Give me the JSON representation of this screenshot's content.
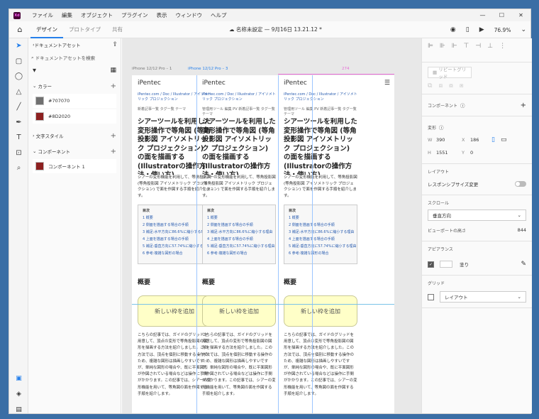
{
  "app": {
    "logo": "Xd",
    "menu": [
      "ファイル",
      "編集",
      "オブジェクト",
      "プラグイン",
      "表示",
      "ウィンドウ",
      "ヘルプ"
    ],
    "window_controls": [
      "—",
      "☐",
      "✕"
    ]
  },
  "toolbar": {
    "tabs": [
      "デザイン",
      "プロトタイプ",
      "共有"
    ],
    "doc_title": "☁ 名称未設定 — 9月16日 13.21.12 *",
    "zoom": "76.9%"
  },
  "left_panel": {
    "header": "ドキュメントアセット",
    "search_placeholder": "ドキュメントアセットを検索",
    "colors_label": "カラー",
    "colors": [
      {
        "label": "#707070",
        "hex": "#707070"
      },
      {
        "label": "#8D2020",
        "hex": "#8D2020"
      }
    ],
    "char_styles_label": "文字スタイル",
    "components_label": "コンポーネント",
    "components": [
      {
        "label": "コンポーネント 1",
        "hex": "#8D2020"
      }
    ]
  },
  "canvas": {
    "artboard_labels": [
      "iPhone 12/12 Pro – 1",
      "iPhone 12/12 Pro – 3"
    ],
    "measure_label": "274",
    "columns": [
      {
        "logo": "iPentec",
        "breadcrumb": "iPentec.com / Doc / Illustrator / アイソメトリック プロジェクション",
        "meta": "新着記事一覧  タグ一覧  テーマ",
        "title": "シアーツールを利用した変形操作で等角図 (等角投影図 アイソメトリック プロジェクション) の面を描画する (Illustratorの操作方法・使い方)",
        "desc": "シアーの変形機能を利用して、等角投影図 (等角投影図 アイソメトリック プロジェクション) で面を作図する手順を紹介します。",
        "heading": "概要",
        "box": "新しい枠を追加",
        "body": "こちらの記事では、ガイドのグリッドを用意して、頂点の変形で等角投影図の図形を描画する方法を紹介しました。この方法では、頂点を個別に移動する操作のため、複雑な図形は描画しやすいですが、単純な図形の場合や、既に平面図形が作図されている場合などは操作に手間がかかります。この記事では、シアーの変形機能を用いて、等角図の面を作図する手順を紹介します。"
      },
      {
        "logo": "iPentec",
        "breadcrumb": "iPentec.com / Doc / Illustrator / アイソメトリック プロジェクション",
        "meta": "管理用ツール 編集 PV  新着記事一覧  タグ一覧  テーマ",
        "title": "シアーツールを利用した変形操作で等角図 (等角投影図 アイソメトリック プロジェクション) の面を描画する (Illustratorの操作方法・使い方)",
        "desc": "シアーの変形機能を利用して、等角投影図 (等角投影図 アイソメトリック プロジェクション) で面を作図する手順を紹介します。",
        "heading": "概要",
        "box": "新しい枠を追加",
        "body": "こちらの記事では、ガイドのグリッドを用意して、頂点の変形で等角投影図の図形を描画する方法を紹介しました。この方法では、頂点を個別に移動する操作のため、複雑な図形は描画しやすいですが、単純な図形の場合や、既に平面図形が作図されている場合などは操作に手間がかかります。この記事では、シアーの変形機能を用いて、等角図の面を作図する手順を紹介します。"
      },
      {
        "logo": "iPentec",
        "breadcrumb": "iPentec.com / Doc / Illustrator / アイソメトリック プロジェクション",
        "meta": "管理用ツール 編集 PV  新着記事一覧  タグ一覧  テーマ",
        "title": "シアーツールを利用した変形操作で等角図 (等角投影図 アイソメトリック プロジェクション) の面を描画する (Illustratorの操作方法・使い方)",
        "desc": "シアーの変形機能を利用して、等角投影図 (等角投影図 アイソメトリック プロジェクション) で面を作図する手順を紹介します。",
        "heading": "概要",
        "box": "新しい枠を追加",
        "body": "こちらの記事では、ガイドのグリッドを用意して、頂点の変形で等角投影図の図形を描画する方法を紹介しました。この方法では、頂点を個別に移動する操作のため、複雑な図形は描画しやすいですが、単純な図形の場合や、既に平面図形が作図されている場合などは操作に手間がかかります。この記事では、シアーの変形機能を用いて、等角図の面を作図する手順を紹介します。"
      }
    ],
    "toc": {
      "title": "目次",
      "items": [
        "1 概要",
        "2 側面を描画する場合の手順",
        "3 補足:水平方向に86.6%に縮小する理由",
        "4 上面を描画する場合の手順",
        "5 補足:垂直方向に57.74%に縮小する理由",
        "6 参考:複雑な図形の場合"
      ]
    }
  },
  "right_panel": {
    "repeat_grid": "リピートグリッド",
    "component_label": "コンポーネント",
    "transform_label": "変形",
    "w": "390",
    "x": "186",
    "h": "1551",
    "y": "0",
    "layout_label": "レイアウト",
    "responsive_label": "レスポンシブサイズ変更",
    "scroll_label": "スクロール",
    "scroll_value": "垂直方向",
    "viewport_label": "ビューポートの高さ",
    "viewport_value": "844",
    "appearance_label": "アピアランス",
    "fill_label": "塗り",
    "grid_label": "グリッド",
    "grid_value": "レイアウト"
  }
}
